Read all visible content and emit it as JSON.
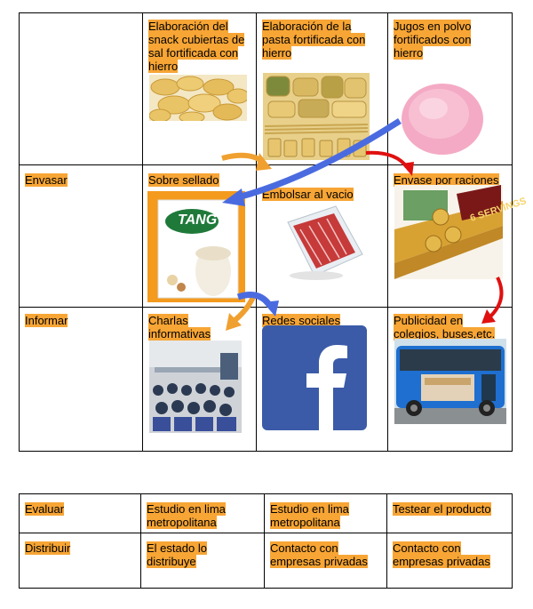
{
  "table_top": {
    "header": [
      "",
      "Elaboración del snack cubiertas de sal fortificada con hierro",
      "Elaboración de la pasta fortificada con hierro",
      "Jugos en polvo fortificados con hierro"
    ],
    "rows": [
      {
        "label": "Envasar",
        "cells": [
          "Sobre sellado",
          "Embolsar al vacio",
          "Envase por raciones"
        ]
      },
      {
        "label": "Informar",
        "cells": [
          "Charlas informativas",
          "Redes sociales",
          "Publicidad en colegios, buses,etc."
        ]
      }
    ]
  },
  "images": {
    "tang_brand": "TANG",
    "ration_label": "6 SERVINGS"
  },
  "table_bottom": {
    "rows": [
      {
        "label": "Evaluar",
        "cells": [
          "Estudio en lima metropolitana",
          "Estudio en lima metropolitana",
          "Testear el producto"
        ]
      },
      {
        "label": "Distribuir",
        "cells": [
          "El estado lo distribuye",
          "Contacto con empresas privadas",
          "Contacto con empresas privadas"
        ]
      }
    ]
  },
  "colors": {
    "highlight": "#f7a535",
    "arrow_orange": "#f0a030",
    "arrow_blue": "#4a6be0",
    "arrow_red": "#e01010",
    "facebook": "#3b5ba8"
  }
}
